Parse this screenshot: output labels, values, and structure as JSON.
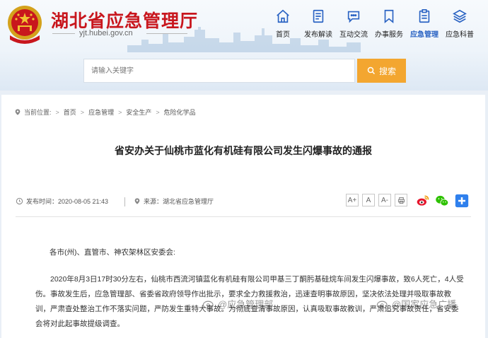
{
  "header": {
    "site_title": "湖北省应急管理厅",
    "site_url": "yjt.hubei.gov.cn"
  },
  "nav": {
    "items": [
      {
        "label": "首页",
        "icon": "home-icon"
      },
      {
        "label": "发布解读",
        "icon": "document-icon"
      },
      {
        "label": "互动交流",
        "icon": "chat-icon"
      },
      {
        "label": "办事服务",
        "icon": "bookmark-icon"
      },
      {
        "label": "应急管理",
        "icon": "clipboard-icon",
        "active": true
      },
      {
        "label": "应急科普",
        "icon": "layers-icon"
      }
    ],
    "active_color": "#2a63c3"
  },
  "search": {
    "placeholder": "请输入关键字",
    "button_label": "搜索",
    "button_color": "#f3a630"
  },
  "breadcrumb": {
    "prefix": "当前位置:",
    "items": [
      "首页",
      "应急管理",
      "安全生产",
      "危险化学品"
    ]
  },
  "article": {
    "title": "省安办关于仙桃市蓝化有机硅有限公司发生闪爆事故的通报",
    "publish_time": "发布时间：2020-08-05 21:43",
    "source": "来源：湖北省应急管理厅",
    "greeting": "各市(州)、直管市、神农架林区安委会:",
    "paragraph": "2020年8月3日17时30分左右，仙桃市西流河镇蓝化有机硅有限公司甲基三丁酮肟基硅烷车间发生闪爆事故，致6人死亡，4人受伤。事故发生后，应急管理部、省委省政府领导作出批示，要求全力救援救治，迅速查明事故原因，坚决依法处理并吸取事故教训，严肃查处整治工作不落实问题，严防发生重特大事故。为彻底查清事故原因，认真吸取事故教训，严肃追究事故责任，省安委会将对此起事故提级调查。"
  },
  "font_size_buttons": [
    "A+",
    "A",
    "A-"
  ],
  "share": {
    "icons": [
      "weibo-icon",
      "wechat-icon",
      "plus-share-icon"
    ]
  },
  "watermarks": [
    "@应急管理部",
    "@国家应急广播"
  ]
}
